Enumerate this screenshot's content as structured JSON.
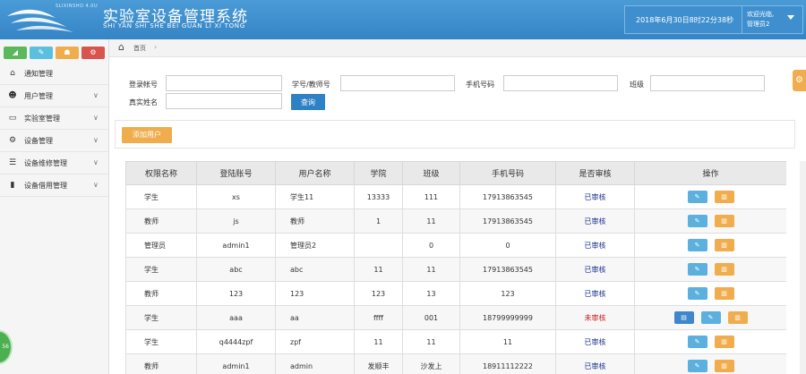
{
  "header": {
    "logo_sub": "SLIXINSHO 4.0U",
    "title": "实验室设备管理系统",
    "pinyin": "SHI YAN SHI SHE BEI GUAN LI XI TONG",
    "datetime": "2018年6月30日8时22分38秒",
    "welcome": "欢迎光临,",
    "user": "管理员2"
  },
  "sidebar": {
    "shortcuts": [
      {
        "icon": "signal-icon",
        "glyph": "◢",
        "color": "#5cb85c"
      },
      {
        "icon": "pencil-icon",
        "glyph": "✎",
        "color": "#5bc0de"
      },
      {
        "icon": "users-icon",
        "glyph": "☗",
        "color": "#f0ad4e"
      },
      {
        "icon": "cogs-icon",
        "glyph": "⚙",
        "color": "#d9534f"
      }
    ],
    "items": [
      {
        "label": "通知管理",
        "icon": "home-icon",
        "glyph": "⌂",
        "chevron": false
      },
      {
        "label": "用户管理",
        "icon": "users-icon",
        "glyph": "☻",
        "chevron": true
      },
      {
        "label": "实验室管理",
        "icon": "monitor-icon",
        "glyph": "▭",
        "chevron": true
      },
      {
        "label": "设备管理",
        "icon": "cogs-icon",
        "glyph": "⚙",
        "chevron": true
      },
      {
        "label": "设备维修管理",
        "icon": "list-icon",
        "glyph": "☰",
        "chevron": true
      },
      {
        "label": "设备借用管理",
        "icon": "bookmark-icon",
        "glyph": "▮",
        "chevron": true
      }
    ]
  },
  "breadcrumb": {
    "home": "首页",
    "arrow": "›"
  },
  "search": {
    "account_label": "登录帐号",
    "number_label": "学号/教师号",
    "phone_label": "手机号码",
    "class_label": "班级",
    "name_label": "真实姓名",
    "query_label": "查询"
  },
  "actions": {
    "add_user": "添加用户"
  },
  "table": {
    "headers": [
      "权限名称",
      "登陆账号",
      "用户名称",
      "学院",
      "班级",
      "手机号码",
      "是否审核",
      "操作"
    ],
    "rows": [
      {
        "role": "学生",
        "account": "xs",
        "name": "学生11",
        "college": "13333",
        "class": "111",
        "phone": "17913863545",
        "status": "已审核",
        "approved": true
      },
      {
        "role": "教师",
        "account": "js",
        "name": "教师",
        "college": "1",
        "class": "11",
        "phone": "17913863545",
        "status": "已审核",
        "approved": true
      },
      {
        "role": "管理员",
        "account": "admin1",
        "name": "管理员2",
        "college": "",
        "class": "0",
        "phone": "0",
        "status": "已审核",
        "approved": true
      },
      {
        "role": "学生",
        "account": "abc",
        "name": "abc",
        "college": "11",
        "class": "11",
        "phone": "17913863545",
        "status": "已审核",
        "approved": true
      },
      {
        "role": "教师",
        "account": "123",
        "name": "123",
        "college": "123",
        "class": "13",
        "phone": "123",
        "status": "已审核",
        "approved": true
      },
      {
        "role": "学生",
        "account": "aaa",
        "name": "aa",
        "college": "ffff",
        "class": "001",
        "phone": "18799999999",
        "status": "未审核",
        "approved": false
      },
      {
        "role": "学生",
        "account": "q4444zpf",
        "name": "zpf",
        "college": "11",
        "class": "11",
        "phone": "11",
        "status": "已审核",
        "approved": true
      },
      {
        "role": "教师",
        "account": "admin1",
        "name": "admin",
        "college": "发顺丰",
        "class": "沙发上",
        "phone": "18911112222",
        "status": "已审核",
        "approved": true
      }
    ]
  },
  "badge": {
    "text": "56"
  },
  "colors": {
    "header": "#3a8bcb",
    "primary": "#2f81c6",
    "warning": "#f0ad4e",
    "info": "#5bb0de",
    "approved": "#1a2f8a",
    "pending": "#c81e1e"
  }
}
